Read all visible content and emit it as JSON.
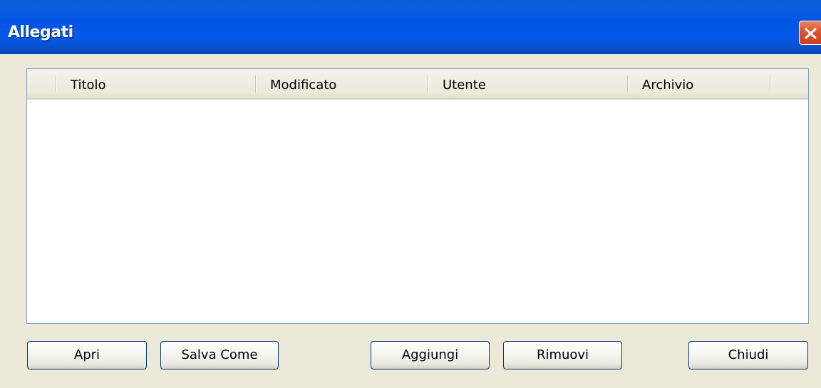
{
  "window": {
    "title": "Allegati"
  },
  "attachments_list": {
    "columns": [
      "",
      "Titolo",
      "Modificato",
      "Utente",
      "Archivio"
    ],
    "rows": []
  },
  "buttons": {
    "open": "Apri",
    "save_as": "Salva Come",
    "add": "Aggiungi",
    "remove": "Rimuovi",
    "close": "Chiudi"
  },
  "colors": {
    "titlebar": "#0258e6",
    "close_button": "#d9542f",
    "dialog_background": "#ece9d8"
  },
  "icons": {
    "close": "close-icon"
  }
}
